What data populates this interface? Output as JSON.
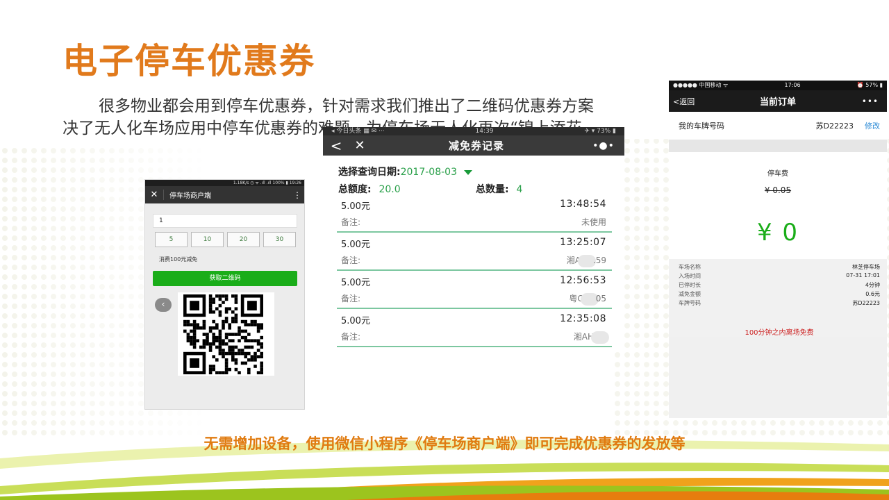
{
  "slide": {
    "title": "电子停车优惠券",
    "paragraph_line1": "很多物业都会用到停车优惠券，针对需求我们推出了二维码优惠券方案",
    "paragraph_line2": "决了无人化车场应用中停车优惠券的难题，为停车场无人化再次“锦上添花",
    "caption": "无需增加设备，使用微信小程序《停车场商户端》即可完成优惠券的发放等",
    "colors": {
      "title": "#e17a1c",
      "caption": "#e07b10",
      "accent_green": "#1aad19"
    }
  },
  "merchant_phone": {
    "status": "1.18K/s ◷ ᯤ .ıll .ıll 100% ▮ 19:26",
    "title": "停车场商户端",
    "close_icon": "close-icon",
    "menu_icon": "more-vert-icon",
    "input_value": "1",
    "amount_options": [
      "5",
      "10",
      "20",
      "30"
    ],
    "note": "消费100元减免",
    "button_label": "获取二维码",
    "back_glyph": "‹"
  },
  "records_phone": {
    "status_left": "◂ 今日头条 ▦ ✉ ···",
    "status_time": "14:39",
    "status_right": "✈ ▾ 73% ▮",
    "title": "减免券记录",
    "back_glyph": "<",
    "close_glyph": "✕",
    "more_glyph": "•●•",
    "date_label": "选择查询日期:",
    "date_value": "2017-08-03",
    "total_amount_label": "总额度:",
    "total_amount_value": "20.0",
    "total_count_label": "总数量:",
    "total_count_value": "4",
    "records": [
      {
        "amount": "5.00元",
        "time": "13:48:54",
        "note_label": "备注:",
        "status_a": "未使用",
        "status_b": ""
      },
      {
        "amount": "5.00元",
        "time": "13:25:07",
        "note_label": "备注:",
        "status_a": "湘A",
        "status_b": ".59"
      },
      {
        "amount": "5.00元",
        "time": "12:56:53",
        "note_label": "备注:",
        "status_a": "粤C",
        "status_b": "05"
      },
      {
        "amount": "5.00元",
        "time": "12:35:08",
        "note_label": "备注:",
        "status_a": "湘AH",
        "status_b": ""
      }
    ]
  },
  "order_phone": {
    "status_left": "●●●●● 中国移动 ᯤ",
    "status_time": "17:06",
    "status_right": "⏰ 57% ▮",
    "back_label": "<返回",
    "title": "当前订单",
    "more_glyph": "•••",
    "plate_label": "我的车牌号码",
    "plate_value": "苏D22223",
    "edit_label": "修改",
    "fee_label": "停车费",
    "original_fee": "¥ 0.05",
    "final_fee": "¥ 0",
    "details": [
      {
        "label": "车场名称",
        "value": "林芝停车场"
      },
      {
        "label": "入场时间",
        "value": "07-31 17:01"
      },
      {
        "label": "已停时长",
        "value": "4分钟"
      },
      {
        "label": "减免金额",
        "value": "0.6元"
      },
      {
        "label": "车牌号码",
        "value": "苏D22223"
      }
    ],
    "free_notice": "100分钟之内离场免费"
  }
}
